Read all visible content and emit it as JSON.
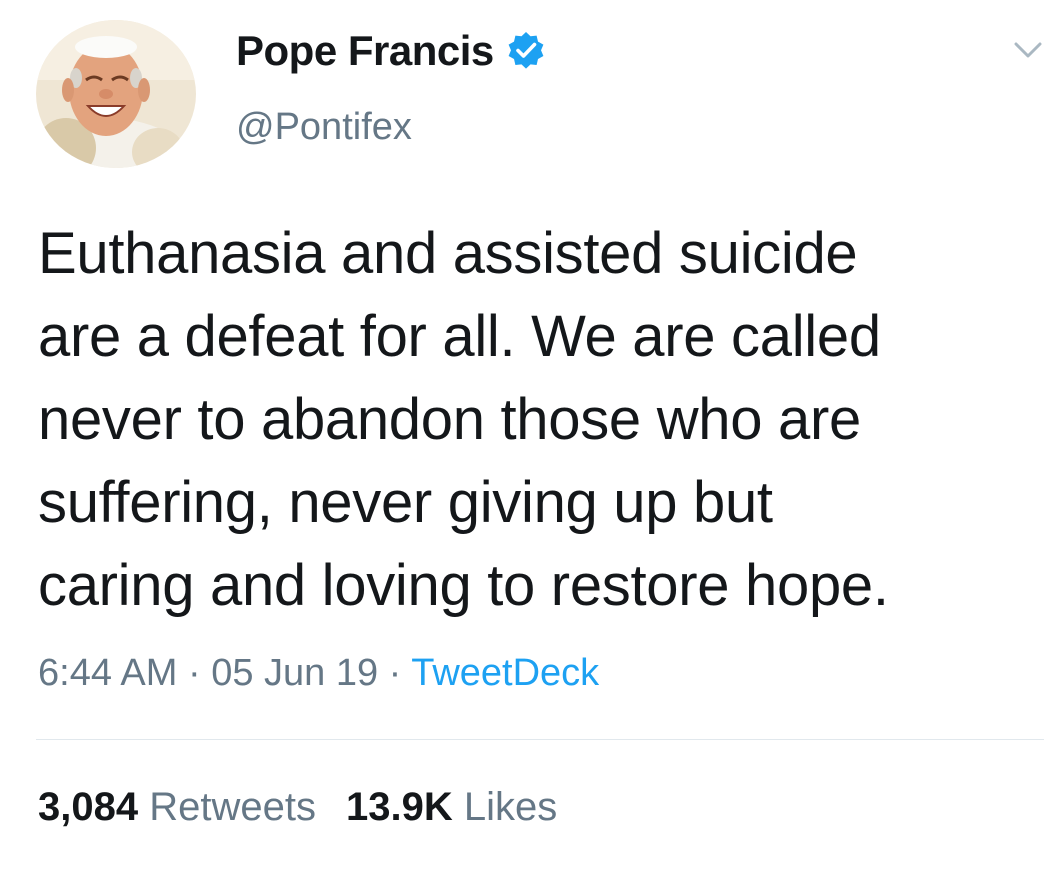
{
  "user": {
    "display_name": "Pope Francis",
    "handle": "@Pontifex",
    "verified": true,
    "avatar_icon": "profile-photo"
  },
  "tweet": {
    "text": "Euthanasia and assisted suicide\nare a defeat for all. We are called\nnever to abandon those who are\nsuffering, never giving up but\ncaring and loving to restore hope."
  },
  "meta": {
    "time": "6:44 AM",
    "separator": " · ",
    "date": "05 Jun 19",
    "source": "TweetDeck"
  },
  "stats": {
    "retweets_count": "3,084",
    "retweets_label": "Retweets",
    "likes_count": "13.9K",
    "likes_label": "Likes"
  },
  "icons": {
    "verified": "verified-badge-icon",
    "more": "chevron-down-icon"
  },
  "colors": {
    "text": "#14171a",
    "secondary": "#657786",
    "accent": "#1da1f2",
    "divider": "#e1e8ed"
  }
}
